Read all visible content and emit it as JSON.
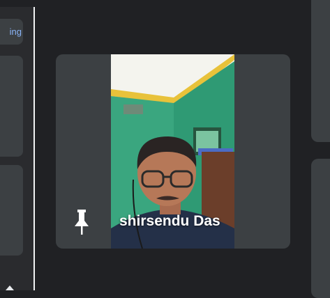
{
  "sidebar": {
    "button_label": "ing"
  },
  "participant": {
    "name": "shirsendu Das"
  },
  "icons": {
    "pin": "pin-icon",
    "scroll_up": "chevron-up-icon"
  },
  "colors": {
    "background": "#202124",
    "tile": "#3c4043",
    "accent": "#8ab4f8"
  }
}
